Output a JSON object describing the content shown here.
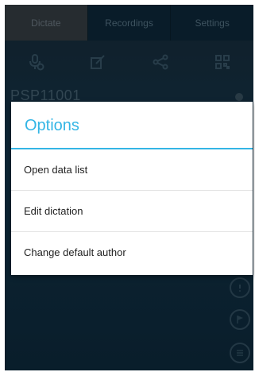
{
  "tabs": [
    {
      "label": "Dictate"
    },
    {
      "label": "Recordings"
    },
    {
      "label": "Settings"
    }
  ],
  "toolbar": {
    "icons": [
      "microphone-add-icon",
      "edit-icon",
      "share-icon",
      "qr-code-icon"
    ]
  },
  "dictation": {
    "id": "PSP11001"
  },
  "dialog": {
    "title": "Options",
    "items": [
      {
        "label": "Open data list"
      },
      {
        "label": "Edit dictation"
      },
      {
        "label": "Change default author"
      }
    ]
  },
  "side_controls": [
    "info-icon",
    "flag-icon",
    "index-icon"
  ],
  "colors": {
    "accent": "#33b5e5",
    "background": "#143a52"
  }
}
